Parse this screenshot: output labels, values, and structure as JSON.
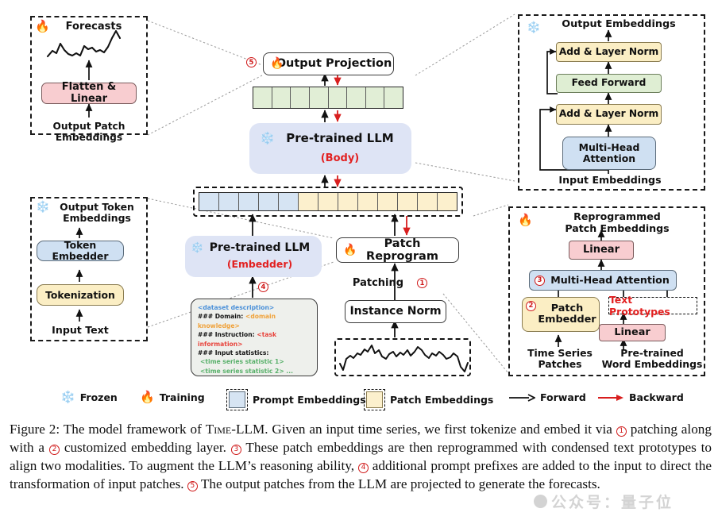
{
  "figure": {
    "panels": {
      "forecasts": {
        "title": "Forecasts",
        "flame_icon": "flame-icon",
        "box_label": "Flatten & Linear",
        "bottom_label": "Output Patch\nEmbeddings"
      },
      "token_embeddings": {
        "snow_icon": "snowflake-icon",
        "title": "Output Token\nEmbeddings",
        "box_token_embedder": "Token Embedder",
        "box_tokenization": "Tokenization",
        "bottom_label": "Input Text"
      },
      "transformer": {
        "snow_icon": "snowflake-icon",
        "title": "Output Embeddings",
        "box_add_norm_top": "Add & Layer Norm",
        "box_feed_forward": "Feed Forward",
        "box_add_norm_bottom": "Add & Layer Norm",
        "box_attention": "Multi-Head\nAttention",
        "bottom_label": "Input Embeddings"
      },
      "reprogram": {
        "flame_icon": "flame-icon",
        "title": "Reprogrammed\nPatch Embeddings",
        "box_linear_top": "Linear",
        "box_attention": "Multi-Head Attention",
        "marker_attention": "3",
        "box_patch_embedder": "Patch\nEmbedder",
        "marker_patch_embedder": "2",
        "box_text_prototypes": "Text Prototypes",
        "box_linear_bottom": "Linear",
        "label_time_series": "Time Series\nPatches",
        "label_word_embeddings": "Pre-trained\nWord Embeddings"
      }
    },
    "center": {
      "output_projection": "Output Projection",
      "output_projection_marker": "5",
      "output_projection_flame": "flame-icon",
      "llm_body_title": "Pre-trained LLM",
      "llm_body_sub": "(Body)",
      "llm_body_snow": "snowflake-icon",
      "llm_embedder_title": "Pre-trained LLM",
      "llm_embedder_sub": "(Embedder)",
      "llm_embedder_snow": "snowflake-icon",
      "llm_embedder_marker": "4",
      "patch_reprogram": "Patch Reprogram",
      "patch_reprogram_flame": "flame-icon",
      "patching_label": "Patching",
      "patching_marker": "1",
      "instance_norm": "Instance Norm",
      "green_cells": 8,
      "prompt_cells": 5,
      "patch_cells": 8
    },
    "prompt": {
      "line1": "<dataset description>",
      "line2_key": "### Domain:",
      "line2_val": "<domain knowledge>",
      "line3_key": "### Instruction:",
      "line3_val": "<task information>",
      "line4_key": "### Input statistics:",
      "line5": "<time series statistic 1>",
      "line6": "<time series statistic 2>  ..."
    },
    "legend": {
      "frozen_icon": "snowflake-icon",
      "frozen": "Frozen",
      "training_icon": "flame-icon",
      "training": "Training",
      "prompt_embeddings": "Prompt Embeddings",
      "patch_embeddings": "Patch Embeddings",
      "forward": "Forward",
      "backward": "Backward"
    },
    "colors": {
      "prompt_cell": "#d6e4f3",
      "patch_cell": "#fcf0cd",
      "output_cell": "#e1eed6",
      "pink_box": "#f8cdd0",
      "blue_box": "#cfe0f2",
      "yellow_box": "#fbeec4",
      "green_box": "#dfeed3",
      "llm_panel": "#dee4f5",
      "backward_arrow": "#d81e1e",
      "marker_red": "#d01a1a"
    }
  },
  "caption": {
    "prefix": "Figure 2:",
    "t1": " The model framework of ",
    "sc": "Time",
    "t2": "-LLM. Given an input time series, we first tokenize and embed it via ",
    "m1": "1",
    "t3": " patching along with a ",
    "m2": "2",
    "t4": " customized embedding layer. ",
    "m3": "3",
    "t5": " These patch embeddings are then reprogrammed with condensed text prototypes to align two modalities.  To augment the LLM’s reasoning ability, ",
    "m4": "4",
    "t6": " additional prompt prefixes are added to the input to direct the transformation of input patches. ",
    "m5": "5",
    "t7": " The output patches from the LLM are projected to generate the forecasts."
  },
  "watermark": {
    "text": "公众号：量子位"
  }
}
